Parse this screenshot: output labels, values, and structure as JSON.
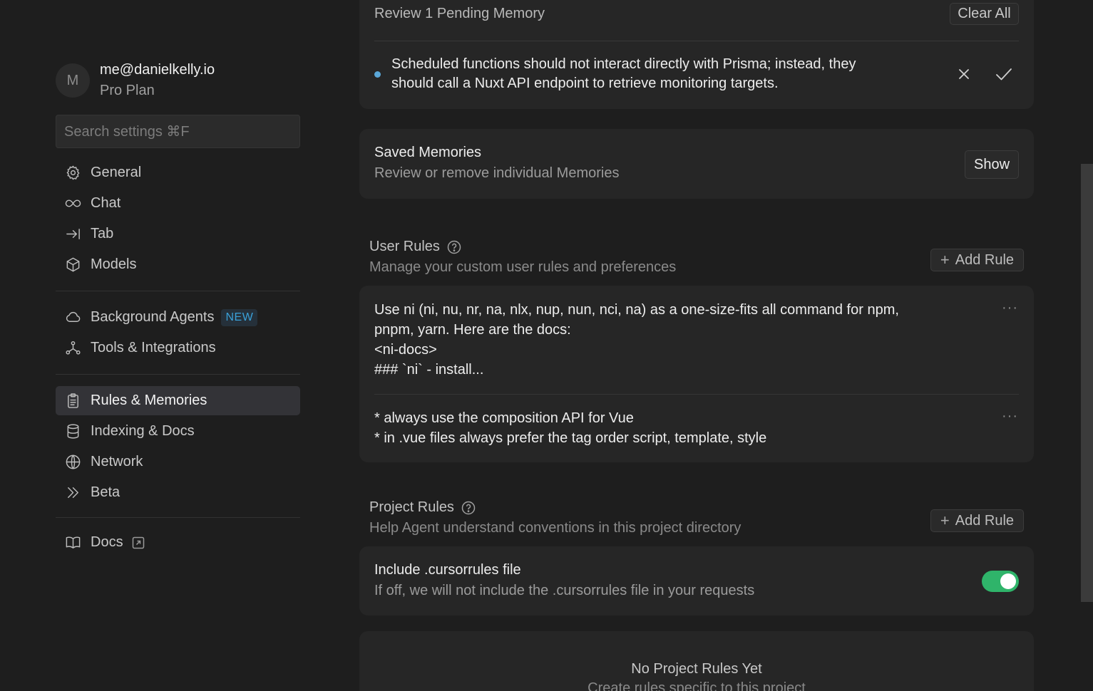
{
  "account": {
    "avatar_letter": "M",
    "email": "me@danielkelly.io",
    "plan": "Pro Plan"
  },
  "search": {
    "placeholder": "Search settings ⌘F"
  },
  "nav": {
    "general": "General",
    "chat": "Chat",
    "tab": "Tab",
    "models": "Models",
    "background_agents": "Background Agents",
    "new_badge": "NEW",
    "tools": "Tools & Integrations",
    "rules_memories": "Rules & Memories",
    "indexing": "Indexing & Docs",
    "network": "Network",
    "beta": "Beta",
    "docs": "Docs"
  },
  "pending": {
    "title": "Review 1 Pending Memory",
    "clear_all": "Clear All",
    "memory_text_line1": "Scheduled functions should not interact directly with Prisma; instead, they",
    "memory_text_line2": "should call a Nuxt API endpoint to retrieve monitoring targets."
  },
  "saved": {
    "title": "Saved Memories",
    "subtitle": "Review or remove individual Memories",
    "show": "Show"
  },
  "user_rules": {
    "title": "User Rules",
    "subtitle": "Manage your custom user rules and preferences",
    "add": "Add Rule",
    "rule1": {
      "line1": "Use ni (ni, nu, nr, na, nlx, nup, nun, nci, na) as a one-size-fits all command for npm,",
      "line2": "pnpm, yarn. Here are the docs:",
      "line3": "<ni-docs>",
      "line4": "### `ni` - install..."
    },
    "rule2": {
      "line1": "* always use the composition API for Vue",
      "line2": "* in .vue files always prefer the tag order script, template, style"
    },
    "more": "···"
  },
  "project_rules": {
    "title": "Project Rules",
    "subtitle": "Help Agent understand conventions in this project directory",
    "add": "Add Rule",
    "include_title": "Include .cursorrules file",
    "include_sub": "If off, we will not include the .cursorrules file in your requests",
    "include_enabled": true,
    "empty_title": "No Project Rules Yet",
    "empty_sub": "Create rules specific to this project"
  },
  "colors": {
    "accent_toggle": "#2fb46a",
    "badge_new": "#3aa0d8",
    "pending_dot": "#5aa7d8"
  }
}
